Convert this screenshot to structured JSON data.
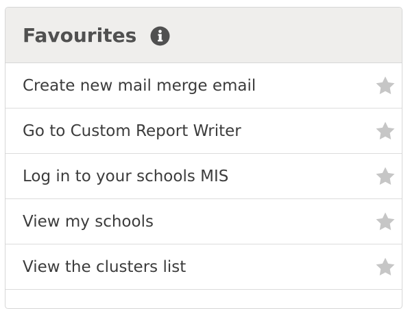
{
  "panel": {
    "title": "Favourites",
    "info_icon": "info-circle-icon"
  },
  "favourites": [
    {
      "label": "Create new mail merge email",
      "icon": "star-icon"
    },
    {
      "label": "Go to Custom Report Writer",
      "icon": "star-icon"
    },
    {
      "label": "Log in to your schools MIS",
      "icon": "star-icon"
    },
    {
      "label": "View my schools",
      "icon": "star-icon"
    },
    {
      "label": "View the clusters list",
      "icon": "star-icon"
    }
  ],
  "colors": {
    "header_bg": "#efeeec",
    "border": "#d6d6d6",
    "text": "#3c3c3c",
    "star": "#c6c6c6",
    "info_icon": "#505050"
  }
}
